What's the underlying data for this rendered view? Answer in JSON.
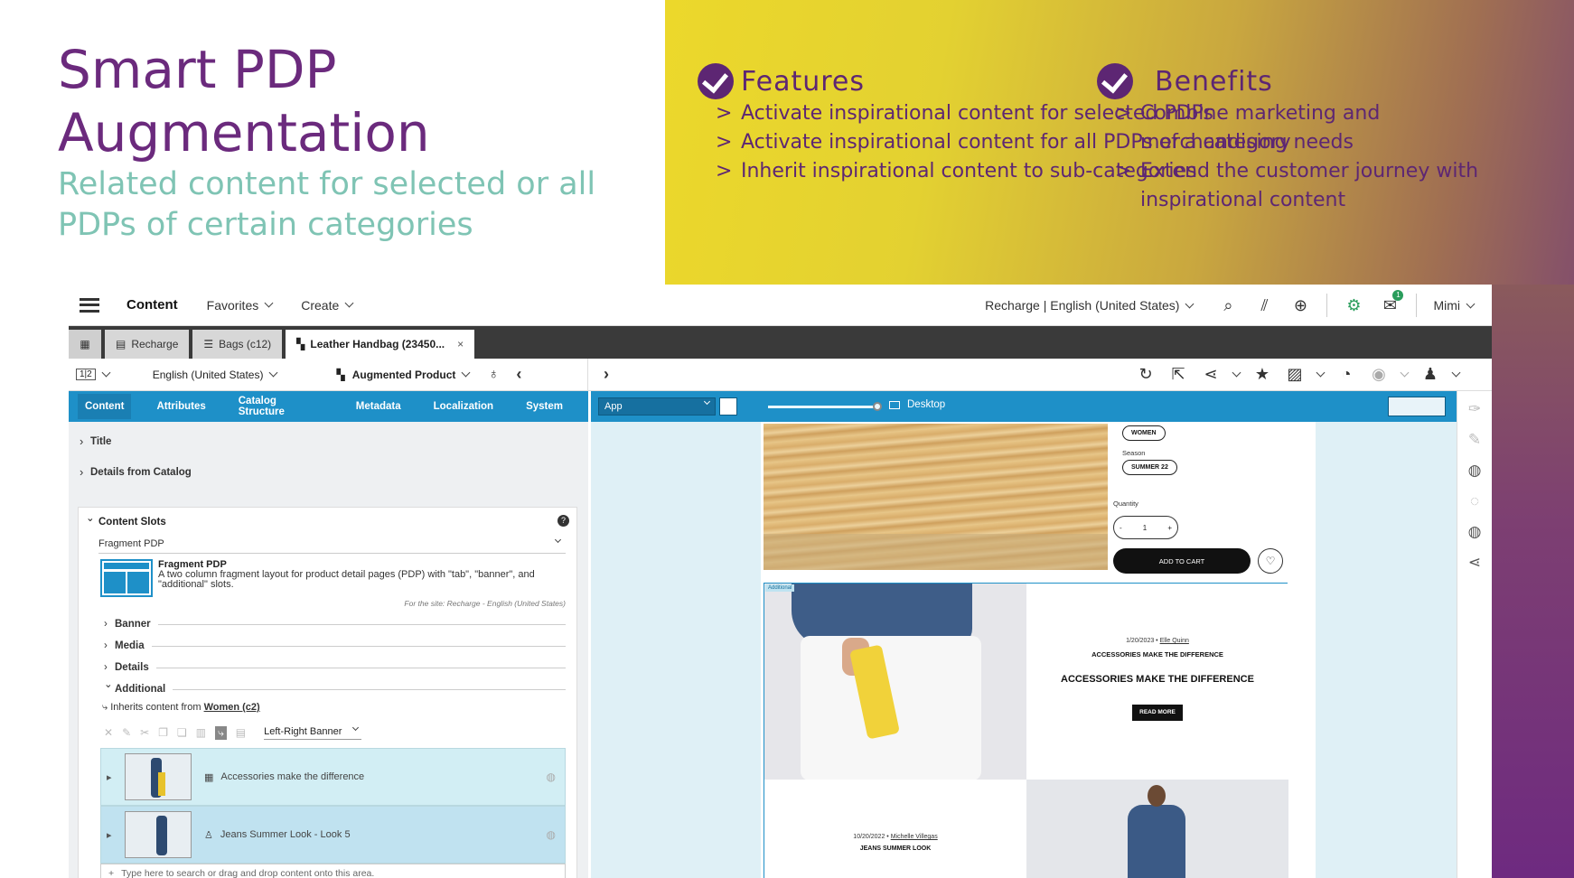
{
  "slide": {
    "title": "Smart PDP Augmentation",
    "subtitle": "Related content for selected or all PDPs of certain categories",
    "features": {
      "heading": "Features",
      "items": [
        "Activate inspirational content for selected PDPs",
        "Activate inspirational content for all PDPs of a category",
        "Inherit inspirational content to sub-categories"
      ]
    },
    "benefits": {
      "heading": "Benefits",
      "items": [
        "Combine marketing and merchandising needs",
        "Extend the customer journey with inspirational content"
      ]
    },
    "colors": {
      "title": "#6b2a7d",
      "subtitle": "#7fc4b4",
      "accent": "#5d2673",
      "panel_start": "#ecd82b",
      "panel_end": "#84506a"
    }
  },
  "app": {
    "topbar": {
      "menu_icon": "hamburger-icon",
      "content": "Content",
      "favorites": "Favorites",
      "create": "Create",
      "site": "Recharge | English (United States)",
      "user": "Mimi",
      "notifications_count": "1"
    },
    "tabs": [
      {
        "label": "Recharge",
        "icon": "store-icon"
      },
      {
        "label": "Bags (c12)",
        "icon": "category-icon"
      },
      {
        "label": "Leather Handbag (23450...",
        "icon": "product-icon"
      }
    ],
    "tab_close": "×",
    "toolbar": {
      "columns": "1|2",
      "locale": "English (United States)",
      "product_type": "Augmented Product"
    },
    "editor_tabs": [
      "Content",
      "Attributes",
      "Catalog Structure",
      "Metadata",
      "Localization",
      "System"
    ],
    "sections": {
      "title": "Title",
      "details_catalog": "Details from Catalog",
      "content_slots": "Content Slots"
    },
    "help": "?",
    "layout_select": "Fragment PDP",
    "fragment": {
      "name": "Fragment PDP",
      "description": "A two column fragment layout for product detail pages (PDP) with \"tab\", \"banner\", and \"additional\" slots.",
      "note": "For the site: Recharge - English (United States)"
    },
    "slots": [
      "Banner",
      "Media",
      "Details",
      "Additional"
    ],
    "inherits_prefix": "Inherits content from",
    "inherits_link": "Women (c2)",
    "banner_select": "Left-Right Banner",
    "items": [
      "Accessories make the difference",
      "Jeans Summer Look - Look 5"
    ],
    "drop_placeholder": "Type here to search or drag and drop content onto this area.",
    "preview": {
      "app_select": "App",
      "device": "Desktop",
      "zoom": 1.0,
      "chip_women": "WOMEN",
      "season_label": "Season",
      "chip_season": "SUMMER 22",
      "quantity_label": "Quantity",
      "qty_minus": "-",
      "qty_value": "1",
      "qty_plus": "+",
      "add_to_cart": "ADD TO CART",
      "slot_tag": "Additional",
      "article1_date": "1/20/2023 •",
      "article1_author": "Elle Quinn",
      "article1_kicker": "ACCESSORIES MAKE THE DIFFERENCE",
      "article1_title": "ACCESSORIES MAKE THE DIFFERENCE",
      "read_more": "READ MORE",
      "article2_date": "10/20/2022 •",
      "article2_author": "Michelle Villegas",
      "article2_title": "JEANS SUMMER LOOK"
    }
  }
}
